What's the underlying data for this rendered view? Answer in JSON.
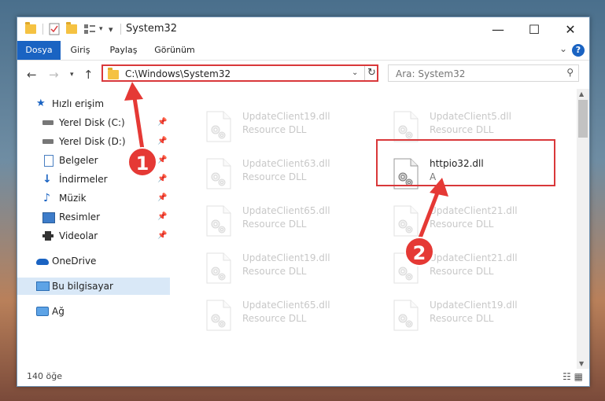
{
  "window": {
    "title": "System32"
  },
  "ribbon": {
    "tabs": [
      "Dosya",
      "Giriş",
      "Paylaş",
      "Görünüm"
    ]
  },
  "address": {
    "path": "C:\\Windows\\System32"
  },
  "search": {
    "placeholder": "Ara: System32"
  },
  "sidebar": {
    "quick_access": "Hızlı erişim",
    "items": [
      "Yerel Disk (C:)",
      "Yerel Disk (D:)",
      "Belgeler",
      "İndirmeler",
      "Müzik",
      "Resimler",
      "Videolar"
    ],
    "onedrive": "OneDrive",
    "this_pc": "Bu bilgisayar",
    "network": "Ağ"
  },
  "files": [
    {
      "name": "UpdateClient19.dll",
      "type": "Resource DLL"
    },
    {
      "name": "UpdateClient5.dll",
      "type": "Resource DLL"
    },
    {
      "name": "UpdateClient63.dll",
      "type": "Resource DLL"
    },
    {
      "name": "httpio32.dll",
      "type": "A"
    },
    {
      "name": "UpdateClient65.dll",
      "type": "Resource DLL"
    },
    {
      "name": "UpdateClient21.dll",
      "type": "Resource DLL"
    },
    {
      "name": "UpdateClient19.dll",
      "type": "Resource DLL"
    },
    {
      "name": "UpdateClient21.dll",
      "type": "Resource DLL"
    },
    {
      "name": "UpdateClient65.dll",
      "type": "Resource DLL"
    },
    {
      "name": "UpdateClient19.dll",
      "type": "Resource DLL"
    }
  ],
  "status": {
    "count": "140 öğe"
  },
  "annotations": [
    "1",
    "2"
  ],
  "colors": {
    "accent": "#1a63c2",
    "highlight": "#d9383a"
  }
}
